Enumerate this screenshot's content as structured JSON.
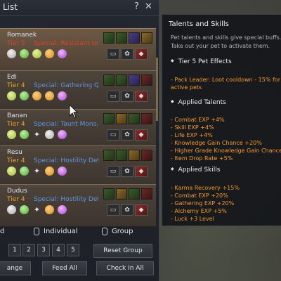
{
  "window": {
    "title": "List",
    "help": "?",
    "close": "✕"
  },
  "pets": [
    {
      "name": "Romanek",
      "tier": "Tier 5",
      "special": "Special: Resistant to..."
    },
    {
      "name": "Edi",
      "tier": "Tier 4",
      "special": "Special: Gathering Q..."
    },
    {
      "name": "Banan",
      "tier": "Tier 4",
      "special": "Special: Taunt Mons..."
    },
    {
      "name": "Resu",
      "tier": "Tier 4",
      "special": "Special: Hostility Det..."
    },
    {
      "name": "Dudus",
      "tier": "Tier 4",
      "special": "Special: Hostility Det..."
    }
  ],
  "controls": {
    "left_label": "d",
    "individual": "Individual",
    "group": "Group",
    "groups": [
      "1",
      "2",
      "3",
      "4",
      "5"
    ],
    "reset_group": "Reset Group",
    "change": "ange",
    "feed_all": "Feed All",
    "check_in_all": "Check In All"
  },
  "tooltip": {
    "title": "Talents and Skills",
    "desc1": "Pet talents and skills give special buffs.",
    "desc2": "Take out your pet to activate them.",
    "tier5_heading": "Tier 5 Pet Effects",
    "tier5_line1": "- Pack Leader: Loot cooldown - 15% for",
    "tier5_line2": "active pets",
    "talents_heading": "Applied Talents",
    "talents": [
      "- Combat EXP +4%",
      "- Skill EXP +4%",
      "- Life EXP +4%",
      "- Knowledge Gain Chance +20%",
      "- Higher Grade Knowledge Gain Chance",
      "- Item Drop Rate +5%"
    ],
    "skills_heading": "Applied Skills",
    "skills": [
      "- Karma Recovery +15%",
      "- Combat EXP +20%",
      "- Gathering EXP +20%",
      "- Alchemy EXP +5%",
      "- Luck +3 Level"
    ]
  }
}
